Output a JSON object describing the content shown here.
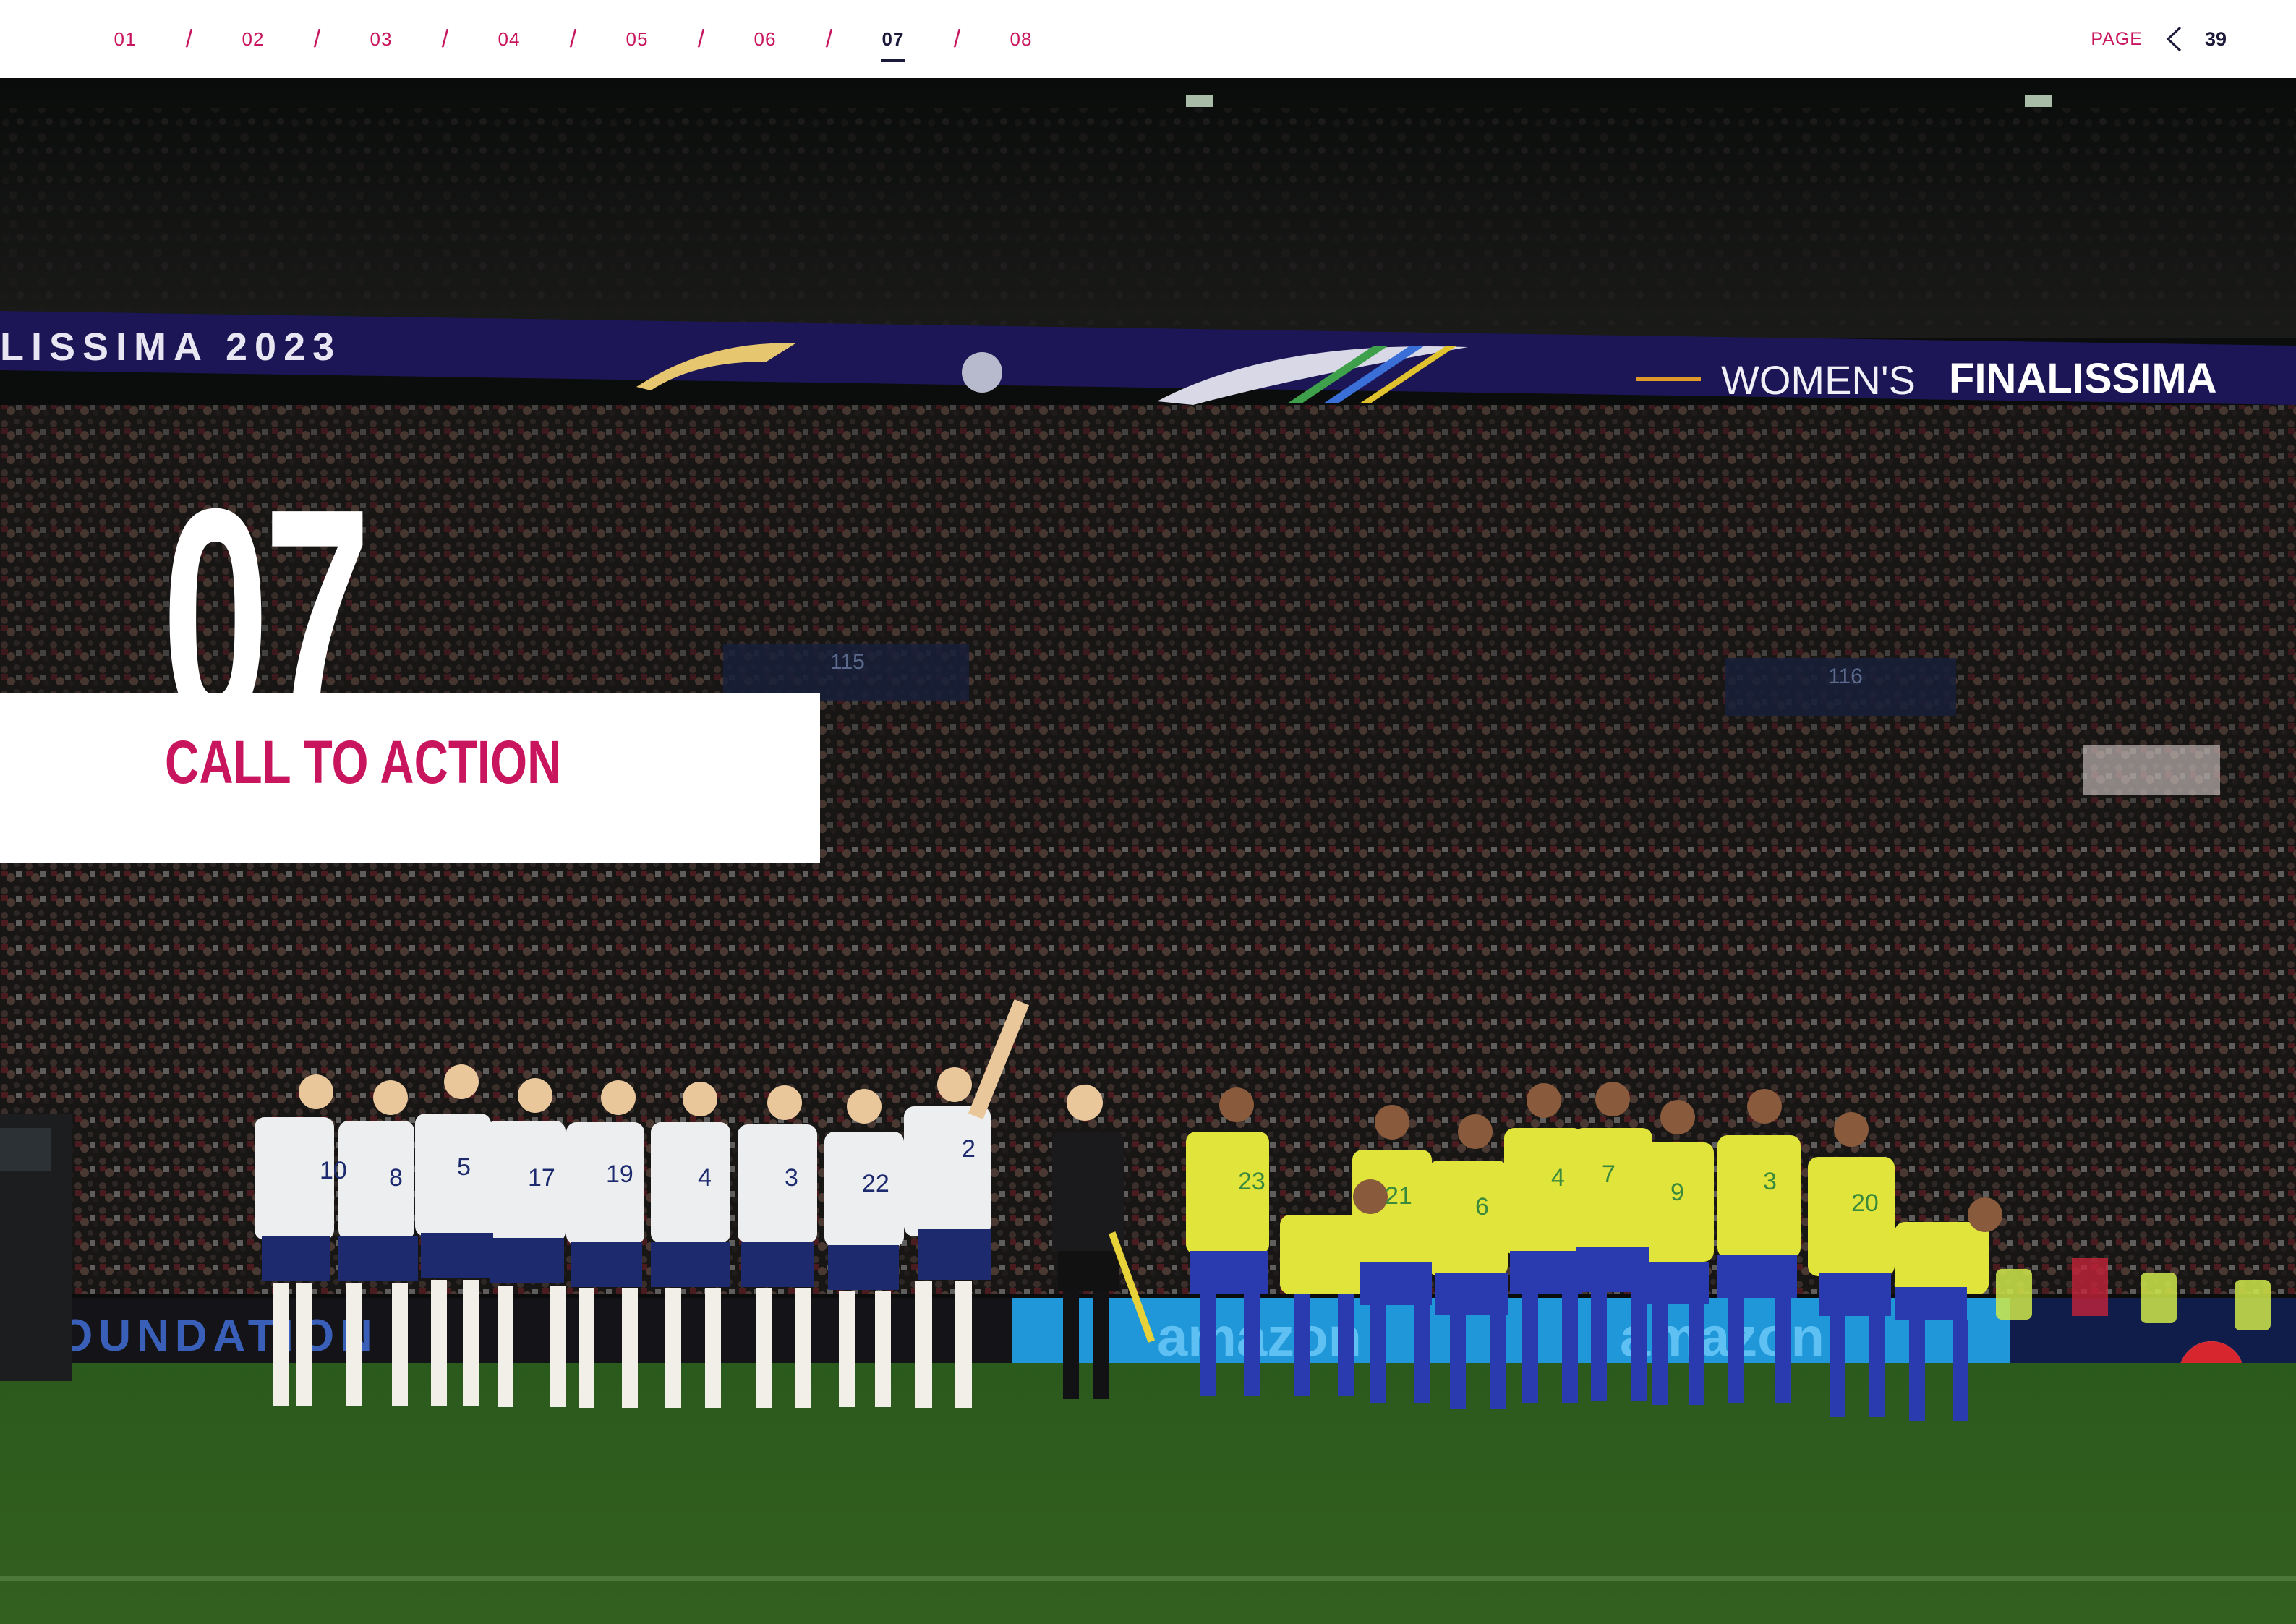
{
  "nav": {
    "chapters": [
      "01",
      "02",
      "03",
      "04",
      "05",
      "06",
      "07",
      "08"
    ],
    "active_chapter": "07",
    "separator": "/",
    "page_label": "PAGE",
    "page_number": "39"
  },
  "section": {
    "number": "07",
    "title": "CALL TO ACTION"
  },
  "photo": {
    "banner_text_left": "LISSIMA 2023",
    "banner_text_right_1": "WOMEN'S",
    "banner_text_right_2": "FINALISSIMA",
    "stand_sign_left": "115",
    "stand_sign_right": "116",
    "england_numbers": [
      "10",
      "8",
      "5",
      "17",
      "19",
      "4",
      "3",
      "22",
      "2"
    ],
    "brazil_numbers": [
      "23",
      "",
      "21",
      "6",
      "4",
      "7",
      "9",
      "3",
      "20",
      ""
    ],
    "ad_board_left": "OUNDATION",
    "ad_board_mid": "amazon",
    "colors": {
      "brand_pink": "#c8155d",
      "navy": "#1b1a3a",
      "pitch_green": "#2d5a1f",
      "england_white": "#eceef0",
      "england_shorts": "#1d2a6e",
      "brazil_yellow": "#e1e43a",
      "brazil_blue": "#2a3bb0"
    }
  }
}
